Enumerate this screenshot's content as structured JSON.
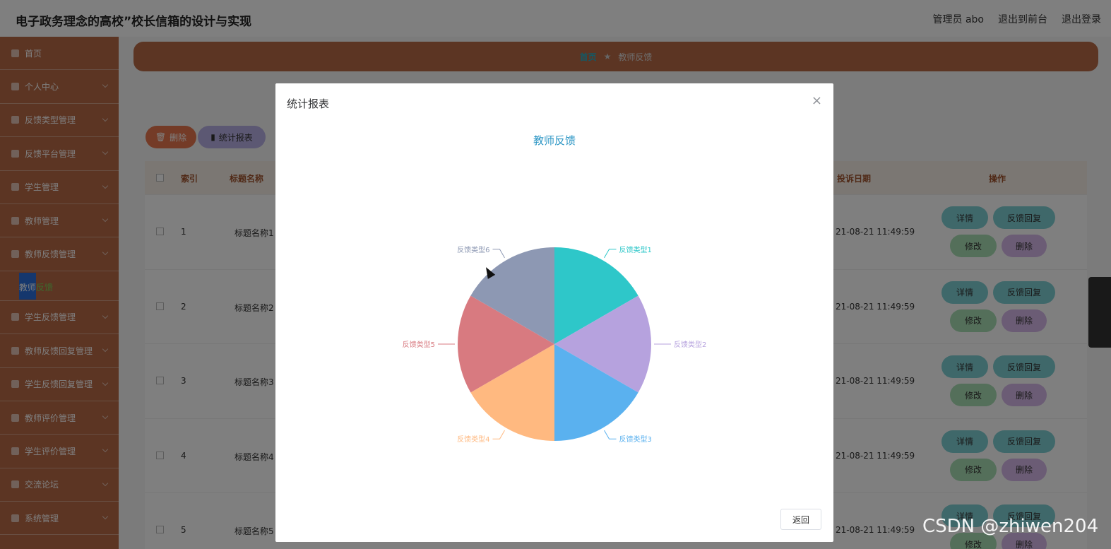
{
  "header": {
    "title": "电子政务理念的高校”校长信箱的设计与实现",
    "user": "管理员 abo",
    "front_link": "退出到前台",
    "logout_link": "退出登录"
  },
  "sidebar": {
    "items": [
      {
        "label": "首页"
      },
      {
        "label": "个人中心"
      },
      {
        "label": "反馈类型管理"
      },
      {
        "label": "反馈平台管理"
      },
      {
        "label": "学生管理"
      },
      {
        "label": "教师管理"
      },
      {
        "label": "教师反馈管理"
      },
      {
        "label": "学生反馈管理"
      },
      {
        "label": "教师反馈回复管理"
      },
      {
        "label": "学生反馈回复管理"
      },
      {
        "label": "教师评价管理"
      },
      {
        "label": "学生评价管理"
      },
      {
        "label": "交流论坛"
      },
      {
        "label": "系统管理"
      }
    ],
    "sub_active_part1": "教师",
    "sub_active_part2": "反馈"
  },
  "breadcrumb": {
    "home": "首页",
    "current": "教师反馈"
  },
  "toolbar": {
    "delete_label": "删除",
    "stats_label": "统计报表"
  },
  "table": {
    "headers": {
      "index": "索引",
      "title": "标题名称",
      "date": "投诉日期",
      "ops": "操作"
    },
    "rows": [
      {
        "index": "1",
        "title": "标题名称1",
        "date": "21-08-21 11:49:59"
      },
      {
        "index": "2",
        "title": "标题名称2",
        "date": "21-08-21 11:49:59"
      },
      {
        "index": "3",
        "title": "标题名称3",
        "date": "21-08-21 11:49:59"
      },
      {
        "index": "4",
        "title": "标题名称4",
        "date": "21-08-21 11:49:59"
      },
      {
        "index": "5",
        "title": "标题名称5",
        "date": "21-08-21 11:49:59"
      }
    ],
    "actions": {
      "detail": "详情",
      "reply": "反馈回复",
      "edit": "修改",
      "delete": "删除"
    }
  },
  "modal": {
    "title": "统计报表",
    "close": "×",
    "back_label": "返回"
  },
  "chart_data": {
    "type": "pie",
    "title": "教师反馈",
    "categories": [
      "反馈类型1",
      "反馈类型2",
      "反馈类型3",
      "反馈类型4",
      "反馈类型5",
      "反馈类型6"
    ],
    "values": [
      1,
      1,
      1,
      1,
      1,
      1
    ],
    "colors": [
      "#2ec7c9",
      "#b6a2de",
      "#5ab1ef",
      "#ffb980",
      "#d87a80",
      "#8d98b3"
    ]
  },
  "watermark": "CSDN @zhiwen204"
}
